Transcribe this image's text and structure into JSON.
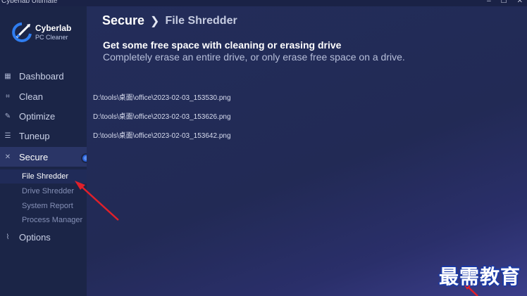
{
  "window": {
    "title": "Cyberlab Ultimate",
    "controls": [
      "–",
      "☐",
      "✕"
    ]
  },
  "sidebar": {
    "brand": "Cyberlab",
    "tagline": "PC Cleaner",
    "items": [
      {
        "label": "Dashboard",
        "icon": "dashboard-icon"
      },
      {
        "label": "Clean",
        "icon": "clean-icon"
      },
      {
        "label": "Optimize",
        "icon": "optimize-icon"
      },
      {
        "label": "Tuneup",
        "icon": "tuneup-icon"
      },
      {
        "label": "Secure",
        "icon": "secure-icon",
        "active": true
      },
      {
        "label": "Options",
        "icon": "options-icon"
      }
    ],
    "sub_items": [
      {
        "label": "File Shredder",
        "active": true
      },
      {
        "label": "Drive Shredder"
      },
      {
        "label": "System Report"
      },
      {
        "label": "Process Manager"
      }
    ]
  },
  "main": {
    "breadcrumb": {
      "primary": "Secure",
      "separator": "❯",
      "secondary": "File Shredder"
    },
    "headline": "Get some free space with cleaning or erasing drive",
    "subline": "Completely erase an entire drive, or only erase free space on a drive.",
    "files": [
      "D:\\tools\\桌面\\office\\2023-02-03_153530.png",
      "D:\\tools\\桌面\\office\\2023-02-03_153626.png",
      "D:\\tools\\桌面\\office\\2023-02-03_153642.png"
    ]
  },
  "watermark": "最需教育",
  "colors": {
    "accent": "#2c63d8",
    "annotation": "#e0202a",
    "background": "#1f2a52"
  }
}
